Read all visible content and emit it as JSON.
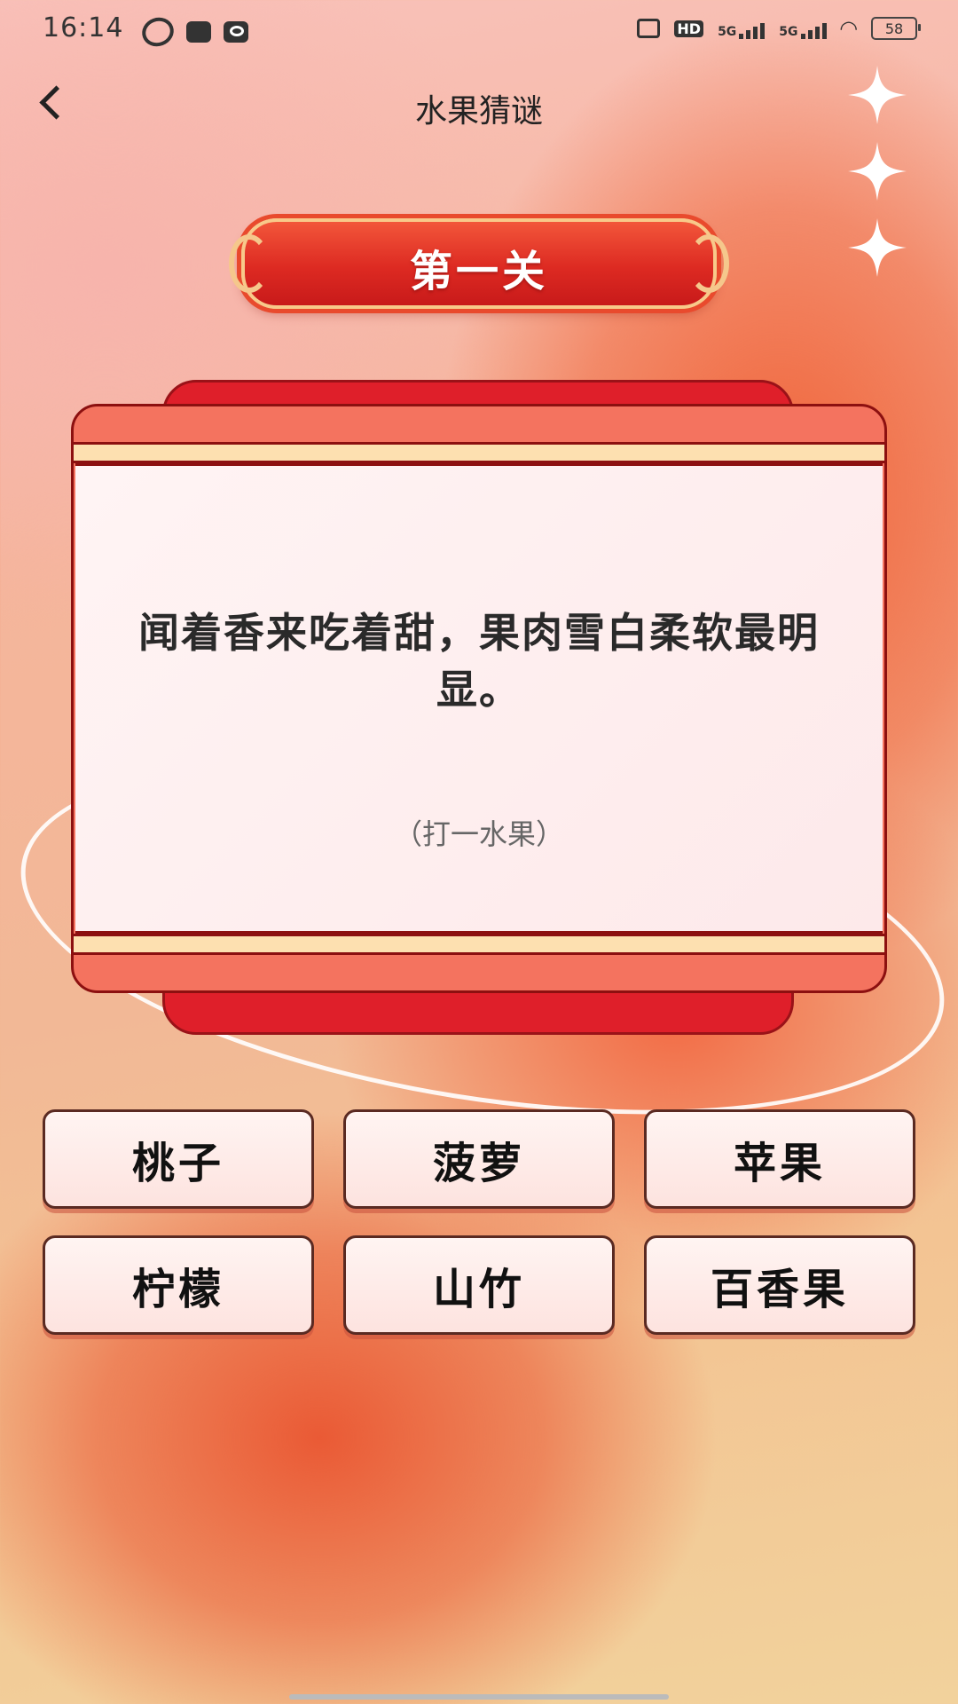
{
  "status_bar": {
    "time": "16:14",
    "network_hd": "HD",
    "network_5g_1": "5G",
    "network_5g_2": "5G",
    "battery": "58"
  },
  "header": {
    "title": "水果猜谜"
  },
  "level": {
    "label": "第一关"
  },
  "riddle": {
    "text": "闻着香来吃着甜，果肉雪白柔软最明显。",
    "hint": "（打一水果）"
  },
  "options": [
    "桃子",
    "菠萝",
    "苹果",
    "柠檬",
    "山竹",
    "百香果"
  ],
  "colors": {
    "banner_red": "#dd2a22",
    "card_back_red": "#df1f2a",
    "card_frame": "#f4735f",
    "band_cream": "#fde0b0",
    "option_bg": "#fde3df"
  }
}
